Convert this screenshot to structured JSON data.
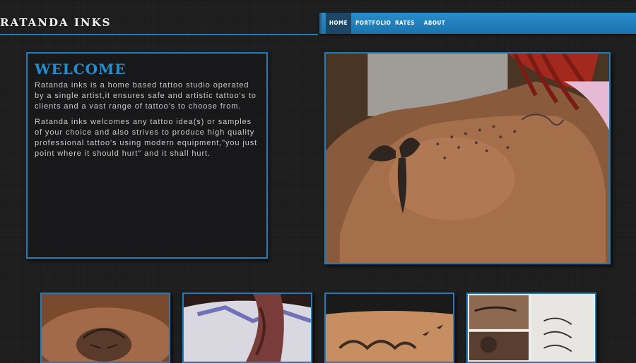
{
  "logo": {
    "text": "RATANDA INKS"
  },
  "nav": {
    "items": [
      {
        "label": "HOME",
        "active": true
      },
      {
        "label": "PORTFOLIO",
        "active": false
      },
      {
        "label": "RATES",
        "active": false
      },
      {
        "label": "ABOUT",
        "active": false
      }
    ]
  },
  "welcome": {
    "title": "WELCOME",
    "paragraph1": "Ratanda inks is a home based tattoo studio operated by a single artist,it ensures safe and artistic tattoo's to clients and a vast range of tattoo's to choose from.",
    "paragraph2": "Ratanda inks welcomes any tattoo idea(s) or samples of your choice and also strives to produce high quality professional tattoo's using modern equipment,\"you just point where it should hurt\" and it shall hurt."
  },
  "colors": {
    "accent": "#1e7ebd",
    "nav_bg": "#1a7fb7",
    "nav_active": "#1d4566",
    "title": "#1f8fd1"
  }
}
